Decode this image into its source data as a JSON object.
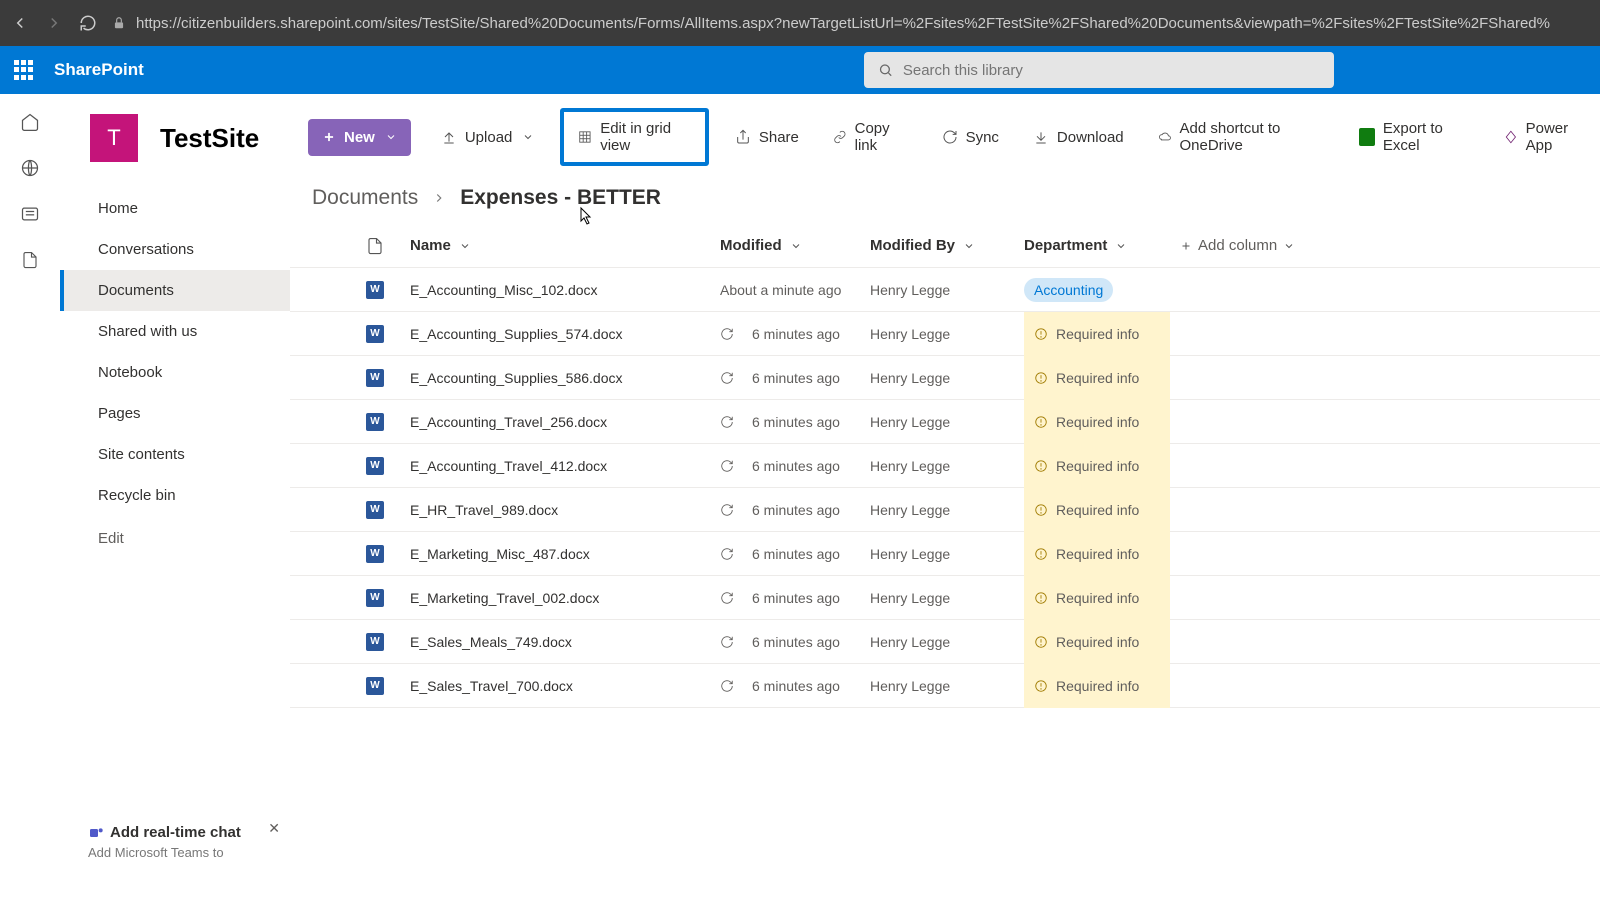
{
  "browser": {
    "url": "https://citizenbuilders.sharepoint.com/sites/TestSite/Shared%20Documents/Forms/AllItems.aspx?newTargetListUrl=%2Fsites%2FTestSite%2FShared%20Documents&viewpath=%2Fsites%2FTestSite%2FShared%"
  },
  "suite": {
    "brand": "SharePoint",
    "search_placeholder": "Search this library"
  },
  "site": {
    "logo_letter": "T",
    "title": "TestSite"
  },
  "nav": {
    "items": [
      "Home",
      "Conversations",
      "Documents",
      "Shared with us",
      "Notebook",
      "Pages",
      "Site contents",
      "Recycle bin"
    ],
    "edit": "Edit",
    "active_index": 2
  },
  "toolbar": {
    "new": "New",
    "upload": "Upload",
    "edit_grid": "Edit in grid view",
    "share": "Share",
    "copy_link": "Copy link",
    "sync": "Sync",
    "download": "Download",
    "shortcut": "Add shortcut to OneDrive",
    "export": "Export to Excel",
    "powerapps": "Power App"
  },
  "breadcrumb": {
    "root": "Documents",
    "current": "Expenses - BETTER"
  },
  "columns": {
    "name": "Name",
    "modified": "Modified",
    "by": "Modified By",
    "dept": "Department",
    "add": "Add column"
  },
  "rows": [
    {
      "name": "E_Accounting_Misc_102.docx",
      "modified": "About a minute ago",
      "by": "Henry Legge",
      "dept": "Accounting",
      "required": false,
      "refresh": false
    },
    {
      "name": "E_Accounting_Supplies_574.docx",
      "modified": "6 minutes ago",
      "by": "Henry Legge",
      "dept": "",
      "required": true,
      "refresh": true
    },
    {
      "name": "E_Accounting_Supplies_586.docx",
      "modified": "6 minutes ago",
      "by": "Henry Legge",
      "dept": "",
      "required": true,
      "refresh": true
    },
    {
      "name": "E_Accounting_Travel_256.docx",
      "modified": "6 minutes ago",
      "by": "Henry Legge",
      "dept": "",
      "required": true,
      "refresh": true
    },
    {
      "name": "E_Accounting_Travel_412.docx",
      "modified": "6 minutes ago",
      "by": "Henry Legge",
      "dept": "",
      "required": true,
      "refresh": true
    },
    {
      "name": "E_HR_Travel_989.docx",
      "modified": "6 minutes ago",
      "by": "Henry Legge",
      "dept": "",
      "required": true,
      "refresh": true
    },
    {
      "name": "E_Marketing_Misc_487.docx",
      "modified": "6 minutes ago",
      "by": "Henry Legge",
      "dept": "",
      "required": true,
      "refresh": true
    },
    {
      "name": "E_Marketing_Travel_002.docx",
      "modified": "6 minutes ago",
      "by": "Henry Legge",
      "dept": "",
      "required": true,
      "refresh": true
    },
    {
      "name": "E_Sales_Meals_749.docx",
      "modified": "6 minutes ago",
      "by": "Henry Legge",
      "dept": "",
      "required": true,
      "refresh": true
    },
    {
      "name": "E_Sales_Travel_700.docx",
      "modified": "6 minutes ago",
      "by": "Henry Legge",
      "dept": "",
      "required": true,
      "refresh": true
    }
  ],
  "required_label": "Required info",
  "promo": {
    "title": "Add real-time chat",
    "sub": "Add Microsoft Teams to"
  }
}
